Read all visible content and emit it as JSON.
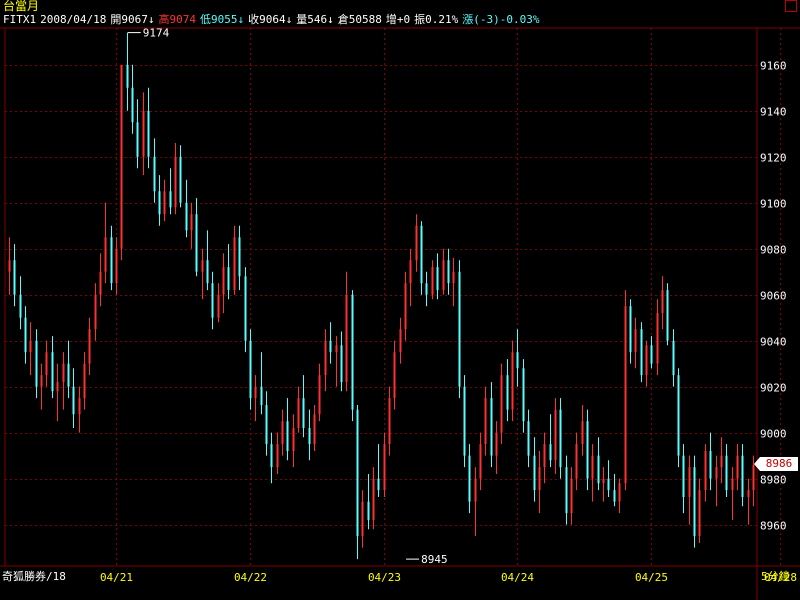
{
  "header": {
    "title": "台當月",
    "symbol": "FITX1",
    "date": "2008/04/18",
    "open": "開9067↓",
    "high": "高9074",
    "low": "低9055↓",
    "close": "收9064↓",
    "volume": "量546↓",
    "open_interest": "倉50588",
    "oi_change": "增+0",
    "amplitude": "振0.21%",
    "change": "漲(-3)-0.03%"
  },
  "footer": {
    "source": "奇狐勝券/18",
    "interval": "5分鐘"
  },
  "last_price": "8986",
  "colors": {
    "background": "#000000",
    "grid": "#800000",
    "up": "#ff3030",
    "down": "#55ffff",
    "axis_text": "#ffffff",
    "title": "#ffff00"
  },
  "chart_data": {
    "type": "candlestick",
    "interval": "5分鐘",
    "ylim": [
      8942,
      9176
    ],
    "y_ticks": [
      8960,
      8980,
      9000,
      9020,
      9040,
      9060,
      9080,
      9100,
      9120,
      9140,
      9160
    ],
    "x_ticks": [
      {
        "label": "04/21",
        "index": 20
      },
      {
        "label": "04/22",
        "index": 45
      },
      {
        "label": "04/23",
        "index": 70
      },
      {
        "label": "04/24",
        "index": 95
      },
      {
        "label": "04/25",
        "index": 120
      },
      {
        "label": "04/28",
        "index": 144
      }
    ],
    "annotations": [
      {
        "label": "9174",
        "index": 22,
        "value": 9174
      },
      {
        "label": "8945",
        "index": 74,
        "value": 8945
      }
    ],
    "last_price": 8986,
    "bars": [
      [
        9070,
        9085,
        9060,
        9075
      ],
      [
        9075,
        9082,
        9055,
        9060
      ],
      [
        9060,
        9068,
        9045,
        9050
      ],
      [
        9050,
        9055,
        9030,
        9035
      ],
      [
        9035,
        9048,
        9025,
        9040
      ],
      [
        9040,
        9045,
        9015,
        9020
      ],
      [
        9020,
        9030,
        9010,
        9025
      ],
      [
        9025,
        9040,
        9020,
        9035
      ],
      [
        9035,
        9042,
        9015,
        9018
      ],
      [
        9018,
        9030,
        9005,
        9022
      ],
      [
        9022,
        9035,
        9010,
        9030
      ],
      [
        9030,
        9040,
        9015,
        9020
      ],
      [
        9020,
        9028,
        9002,
        9008
      ],
      [
        9008,
        9020,
        9000,
        9015
      ],
      [
        9015,
        9035,
        9010,
        9030
      ],
      [
        9030,
        9050,
        9025,
        9045
      ],
      [
        9045,
        9065,
        9040,
        9060
      ],
      [
        9060,
        9078,
        9055,
        9070
      ],
      [
        9070,
        9100,
        9065,
        9085
      ],
      [
        9085,
        9090,
        9062,
        9065
      ],
      [
        9065,
        9085,
        9060,
        9080
      ],
      [
        9080,
        9120,
        9075,
        9160
      ],
      [
        9160,
        9174,
        9140,
        9150
      ],
      [
        9150,
        9160,
        9130,
        9135
      ],
      [
        9135,
        9145,
        9115,
        9120
      ],
      [
        9120,
        9148,
        9112,
        9140
      ],
      [
        9140,
        9150,
        9115,
        9120
      ],
      [
        9120,
        9128,
        9100,
        9105
      ],
      [
        9105,
        9112,
        9090,
        9095
      ],
      [
        9095,
        9110,
        9092,
        9105
      ],
      [
        9105,
        9115,
        9095,
        9098
      ],
      [
        9098,
        9126,
        9095,
        9120
      ],
      [
        9120,
        9125,
        9098,
        9100
      ],
      [
        9100,
        9110,
        9085,
        9088
      ],
      [
        9088,
        9100,
        9080,
        9095
      ],
      [
        9095,
        9102,
        9068,
        9070
      ],
      [
        9070,
        9080,
        9058,
        9075
      ],
      [
        9075,
        9088,
        9062,
        9065
      ],
      [
        9065,
        9070,
        9045,
        9050
      ],
      [
        9050,
        9065,
        9048,
        9060
      ],
      [
        9060,
        9078,
        9052,
        9072
      ],
      [
        9072,
        9082,
        9058,
        9062
      ],
      [
        9062,
        9090,
        9060,
        9085
      ],
      [
        9085,
        9090,
        9062,
        9068
      ],
      [
        9068,
        9072,
        9035,
        9040
      ],
      [
        9040,
        9045,
        9010,
        9015
      ],
      [
        9015,
        9025,
        9005,
        9020
      ],
      [
        9020,
        9035,
        9008,
        9012
      ],
      [
        9012,
        9018,
        8990,
        8995
      ],
      [
        8995,
        9000,
        8978,
        8985
      ],
      [
        8985,
        9000,
        8982,
        8995
      ],
      [
        8995,
        9010,
        8990,
        9005
      ],
      [
        9005,
        9015,
        8988,
        8992
      ],
      [
        8992,
        9008,
        8985,
        9002
      ],
      [
        9002,
        9020,
        9000,
        9015
      ],
      [
        9015,
        9025,
        8998,
        9002
      ],
      [
        9002,
        9010,
        8988,
        8995
      ],
      [
        8995,
        9012,
        8992,
        9008
      ],
      [
        9008,
        9030,
        9005,
        9025
      ],
      [
        9025,
        9045,
        9018,
        9040
      ],
      [
        9040,
        9048,
        9030,
        9035
      ],
      [
        9035,
        9042,
        9020,
        9038
      ],
      [
        9038,
        9044,
        9018,
        9022
      ],
      [
        9022,
        9070,
        9018,
        9060
      ],
      [
        9060,
        9062,
        9005,
        9010
      ],
      [
        9010,
        9012,
        8945,
        8955
      ],
      [
        8955,
        8975,
        8950,
        8970
      ],
      [
        8970,
        8982,
        8958,
        8962
      ],
      [
        8962,
        8985,
        8958,
        8980
      ],
      [
        8980,
        8995,
        8972,
        8975
      ],
      [
        8975,
        9000,
        8972,
        8995
      ],
      [
        8995,
        9020,
        8990,
        9015
      ],
      [
        9015,
        9040,
        9010,
        9035
      ],
      [
        9035,
        9050,
        9030,
        9045
      ],
      [
        9045,
        9070,
        9040,
        9065
      ],
      [
        9065,
        9080,
        9055,
        9075
      ],
      [
        9075,
        9095,
        9070,
        9090
      ],
      [
        9090,
        9092,
        9060,
        9065
      ],
      [
        9065,
        9070,
        9055,
        9060
      ],
      [
        9060,
        9075,
        9058,
        9072
      ],
      [
        9072,
        9078,
        9058,
        9062
      ],
      [
        9062,
        9080,
        9060,
        9075
      ],
      [
        9075,
        9080,
        9060,
        9065
      ],
      [
        9065,
        9076,
        9055,
        9070
      ],
      [
        9070,
        9075,
        9015,
        9020
      ],
      [
        9020,
        9025,
        8985,
        8990
      ],
      [
        8990,
        8995,
        8965,
        8970
      ],
      [
        8970,
        8985,
        8955,
        8980
      ],
      [
        8980,
        9000,
        8975,
        8995
      ],
      [
        8995,
        9020,
        8990,
        9015
      ],
      [
        9015,
        9022,
        8985,
        8990
      ],
      [
        8990,
        9005,
        8982,
        9000
      ],
      [
        9000,
        9030,
        8995,
        9025
      ],
      [
        9025,
        9032,
        9005,
        9010
      ],
      [
        9010,
        9040,
        9005,
        9035
      ],
      [
        9035,
        9045,
        9020,
        9028
      ],
      [
        9028,
        9032,
        9000,
        9005
      ],
      [
        9005,
        9010,
        8985,
        8990
      ],
      [
        8990,
        8998,
        8970,
        8975
      ],
      [
        8975,
        8992,
        8965,
        8985
      ],
      [
        8985,
        9000,
        8978,
        8995
      ],
      [
        8995,
        9008,
        8985,
        8988
      ],
      [
        8988,
        9015,
        8982,
        9010
      ],
      [
        9010,
        9015,
        8980,
        8985
      ],
      [
        8985,
        8990,
        8960,
        8965
      ],
      [
        8965,
        8985,
        8960,
        8980
      ],
      [
        8980,
        9000,
        8975,
        8995
      ],
      [
        8995,
        9012,
        8990,
        9005
      ],
      [
        9005,
        9010,
        8975,
        8980
      ],
      [
        8980,
        8995,
        8970,
        8990
      ],
      [
        8990,
        8998,
        8975,
        8978
      ],
      [
        8978,
        8985,
        8970,
        8980
      ],
      [
        8980,
        8988,
        8972,
        8975
      ],
      [
        8975,
        8982,
        8968,
        8970
      ],
      [
        8970,
        8980,
        8965,
        8978
      ],
      [
        8978,
        9062,
        8975,
        9055
      ],
      [
        9055,
        9058,
        9030,
        9035
      ],
      [
        9035,
        9050,
        9028,
        9045
      ],
      [
        9045,
        9048,
        9022,
        9025
      ],
      [
        9025,
        9040,
        9020,
        9038
      ],
      [
        9038,
        9042,
        9028,
        9030
      ],
      [
        9030,
        9058,
        9025,
        9052
      ],
      [
        9052,
        9068,
        9045,
        9062
      ],
      [
        9062,
        9065,
        9038,
        9040
      ],
      [
        9040,
        9045,
        9020,
        9025
      ],
      [
        9025,
        9028,
        8985,
        8990
      ],
      [
        8990,
        8995,
        8965,
        8972
      ],
      [
        8972,
        8990,
        8960,
        8985
      ],
      [
        8985,
        8990,
        8950,
        8955
      ],
      [
        8955,
        8980,
        8952,
        8975
      ],
      [
        8975,
        8995,
        8970,
        8992
      ],
      [
        8992,
        9000,
        8975,
        8980
      ],
      [
        8980,
        8990,
        8968,
        8985
      ],
      [
        8985,
        8998,
        8978,
        8990
      ],
      [
        8990,
        8995,
        8972,
        8975
      ],
      [
        8975,
        8985,
        8962,
        8980
      ],
      [
        8980,
        8995,
        8975,
        8990
      ],
      [
        8990,
        8995,
        8968,
        8972
      ],
      [
        8972,
        8980,
        8960,
        8975
      ],
      [
        8975,
        8990,
        8968,
        8986
      ]
    ]
  }
}
